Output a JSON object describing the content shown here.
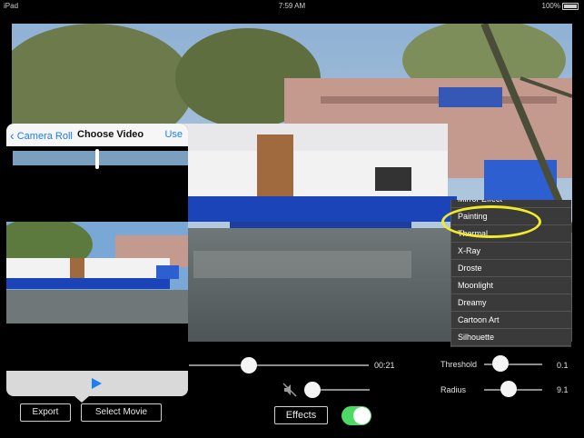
{
  "status_bar": {
    "device": "iPad",
    "time": "7:59 AM",
    "battery": "100%"
  },
  "picker": {
    "back_label": "Camera Roll",
    "title": "Choose Video",
    "use_label": "Use"
  },
  "buttons": {
    "export": "Export",
    "select_movie": "Select Movie",
    "effects": "Effects"
  },
  "playback": {
    "time": "00:21"
  },
  "controls": {
    "threshold_label": "Threshold",
    "threshold_value": "0.1",
    "radius_label": "Radius",
    "radius_value": "9.1"
  },
  "effects_menu": {
    "items": [
      "Mirror Effect",
      "Painting",
      "Thermal",
      "X-Ray",
      "Droste",
      "Moonlight",
      "Dreamy",
      "Cartoon Art",
      "Silhouette"
    ],
    "highlighted": "Painting"
  },
  "toggle_on": true,
  "colors": {
    "accent": "#1a7ef7",
    "toggle": "#4cd964",
    "highlight": "#f0ea2a"
  }
}
